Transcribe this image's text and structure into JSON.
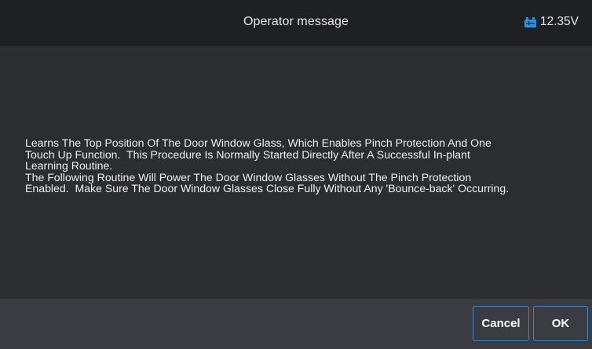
{
  "header": {
    "title": "Operator message",
    "voltage": "12.35V",
    "battery_icon": "vehicle-battery-icon",
    "battery_icon_color": "#2f8fdb"
  },
  "message": {
    "text": "Learns The Top Position Of The Door Window Glass, Which Enables Pinch Protection And One\nTouch Up Function.  This Procedure Is Normally Started Directly After A Successful In-plant\nLearning Routine.\nThe Following Routine Will Power The Door Window Glasses Without The Pinch Protection\nEnabled.  Make Sure The Door Window Glasses Close Fully Without Any 'Bounce-back' Occurring."
  },
  "footer": {
    "cancel_label": "Cancel",
    "ok_label": "OK",
    "button_border_color": "#3c86c9"
  }
}
